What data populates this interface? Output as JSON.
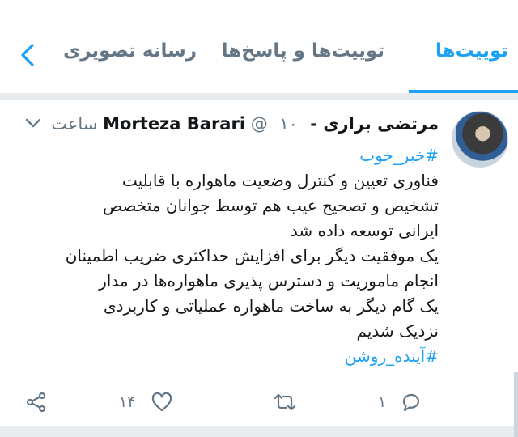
{
  "tabs": {
    "tweets": "توییت‌ها",
    "tweets_replies": "توییت‌ها و پاسخ‌ها",
    "media": "رسانه تصویری"
  },
  "colors": {
    "accent": "#1da1f2",
    "muted": "#657786",
    "divider": "#e8ecef"
  },
  "tweet": {
    "display_name": "مرتضی براری - Morteza Barari",
    "at_sign": "@",
    "time": "۱۰ ساعت",
    "hashtag_top": "#خبر_خوب",
    "lines": [
      "فناوری تعیین و کنترل وضعیت ماهواره با قابلیت",
      "تشخیص و تصحیح عیب هم توسط جوانان متخصص",
      "ایرانی توسعه داده شد",
      "یک موفقیت دیگر برای افزایش حداکثری ضریب اطمینان",
      "انجام ماموریت و دسترس پذیری ماهواره‌ها در مدار",
      "یک گام دیگر به ساخت ماهواره عملیاتی و کاربردی",
      "نزدیک شدیم"
    ],
    "hashtag_bottom": "#آینده_روشن",
    "reply_count": "۱",
    "like_count": "۱۴"
  },
  "icons": {
    "back": "chevron-left-icon",
    "more": "chevron-down-icon",
    "reply": "reply-icon",
    "retweet": "retweet-icon",
    "like": "heart-icon",
    "share": "share-icon"
  }
}
